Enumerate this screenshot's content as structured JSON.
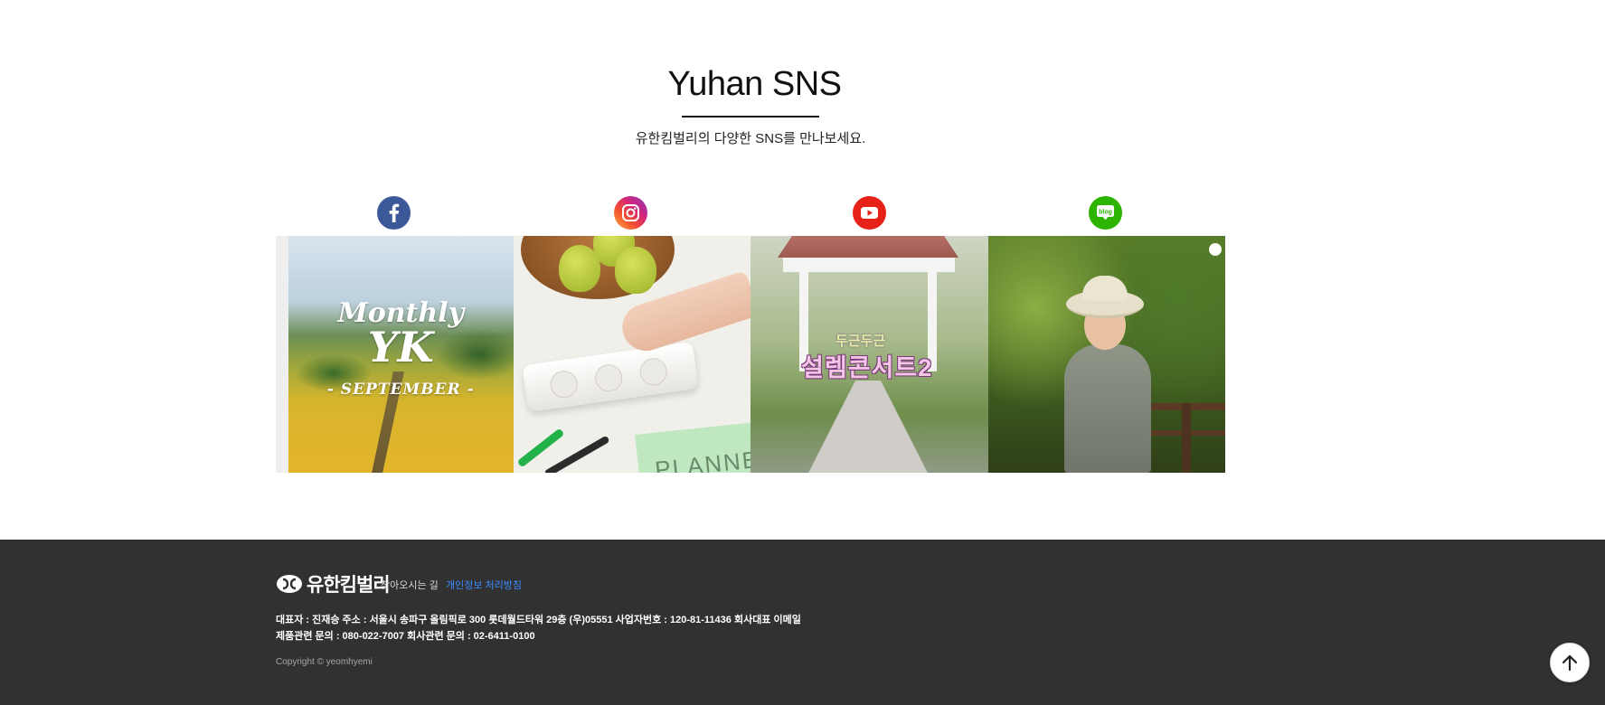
{
  "sns": {
    "title": "Yuhan SNS",
    "subtitle": "유한킴벌리의 다양한 SNS를 만나보세요."
  },
  "icons": [
    "facebook-icon",
    "instagram-icon",
    "youtube-icon",
    "blog-icon"
  ],
  "tiles": {
    "facebook": {
      "line1": "Monthly",
      "line2": "YK",
      "line3": "- SEPTEMBER -"
    },
    "instagram": {
      "planner_text": "PLANNE"
    },
    "youtube": {
      "small_text": "두근두근",
      "big_text": "설렘콘서트2"
    },
    "blog": {}
  },
  "blog_icon_text": "blog",
  "footer": {
    "brand": "유한킴벌리",
    "map_link": "찾아오시는 길",
    "privacy_link": "개인정보 처리방침",
    "info_line1": "대표자 : 진재승 주소 : 서울시 송파구 올림픽로 300 롯데월드타워 29층 (우)05551 사업자번호 : 120-81-11436 회사대표 이메일",
    "info_line2": "제품관련 문의 : 080-022-7007 회사관련 문의 : 02-6411-0100",
    "copyright": "Copyright © yeomhyemi"
  },
  "colors": {
    "facebook": "#3b5998",
    "youtube": "#e62117",
    "blog": "#2db400",
    "footer_bg": "#313131",
    "privacy_link": "#3d8bff"
  }
}
